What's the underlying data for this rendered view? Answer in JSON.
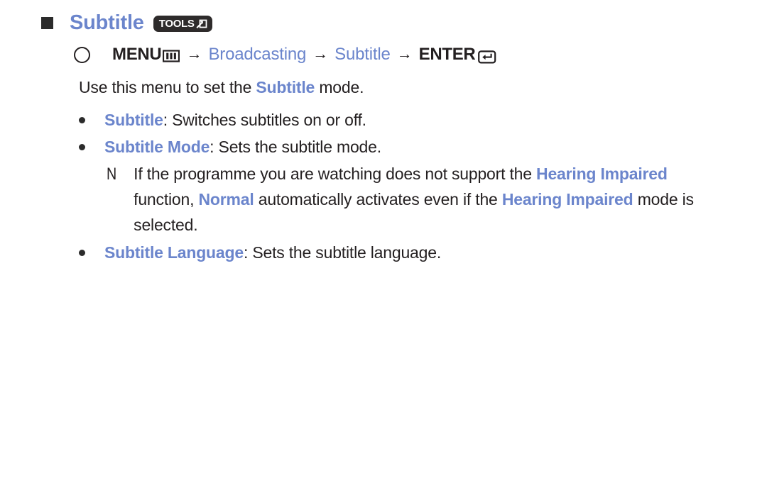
{
  "title": {
    "text": "Subtitle",
    "badge_label": "TOOLS",
    "badge_icon": "tools-arrow-icon",
    "square_bullet_icon": "square-bullet-icon",
    "color": "#6b85cc"
  },
  "menu_path": {
    "circle_icon": "circle-outline-icon",
    "menu_label": "MENU",
    "menu_icon": "menu-grid-icon",
    "arrow1": "→",
    "item1": "Broadcasting",
    "arrow2": "→",
    "item2": "Subtitle",
    "arrow3": "→",
    "enter_label": "ENTER",
    "enter_icon": "enter-return-icon"
  },
  "intro": {
    "part1": "Use this menu to set the ",
    "highlight": "Subtitle",
    "part2": " mode."
  },
  "bullets": [
    {
      "term": "Subtitle",
      "description": ": Switches subtitles on or off."
    },
    {
      "term": "Subtitle Mode",
      "description": ": Sets the subtitle mode."
    },
    {
      "term": "Subtitle Language",
      "description": ": Sets the subtitle language."
    }
  ],
  "note": {
    "marker": "N",
    "seg1": "If the programme you are watching does not support the ",
    "hl1": "Hearing Impaired",
    "seg2": " function, ",
    "hl2": "Normal",
    "seg3": " automatically activates even if the ",
    "hl3": "Hearing Impaired",
    "seg4": " mode is selected."
  },
  "colors": {
    "accent_blue": "#6b85cc",
    "text_black": "#231f20",
    "badge_dark": "#2e2b2b",
    "background": "#ffffff"
  }
}
